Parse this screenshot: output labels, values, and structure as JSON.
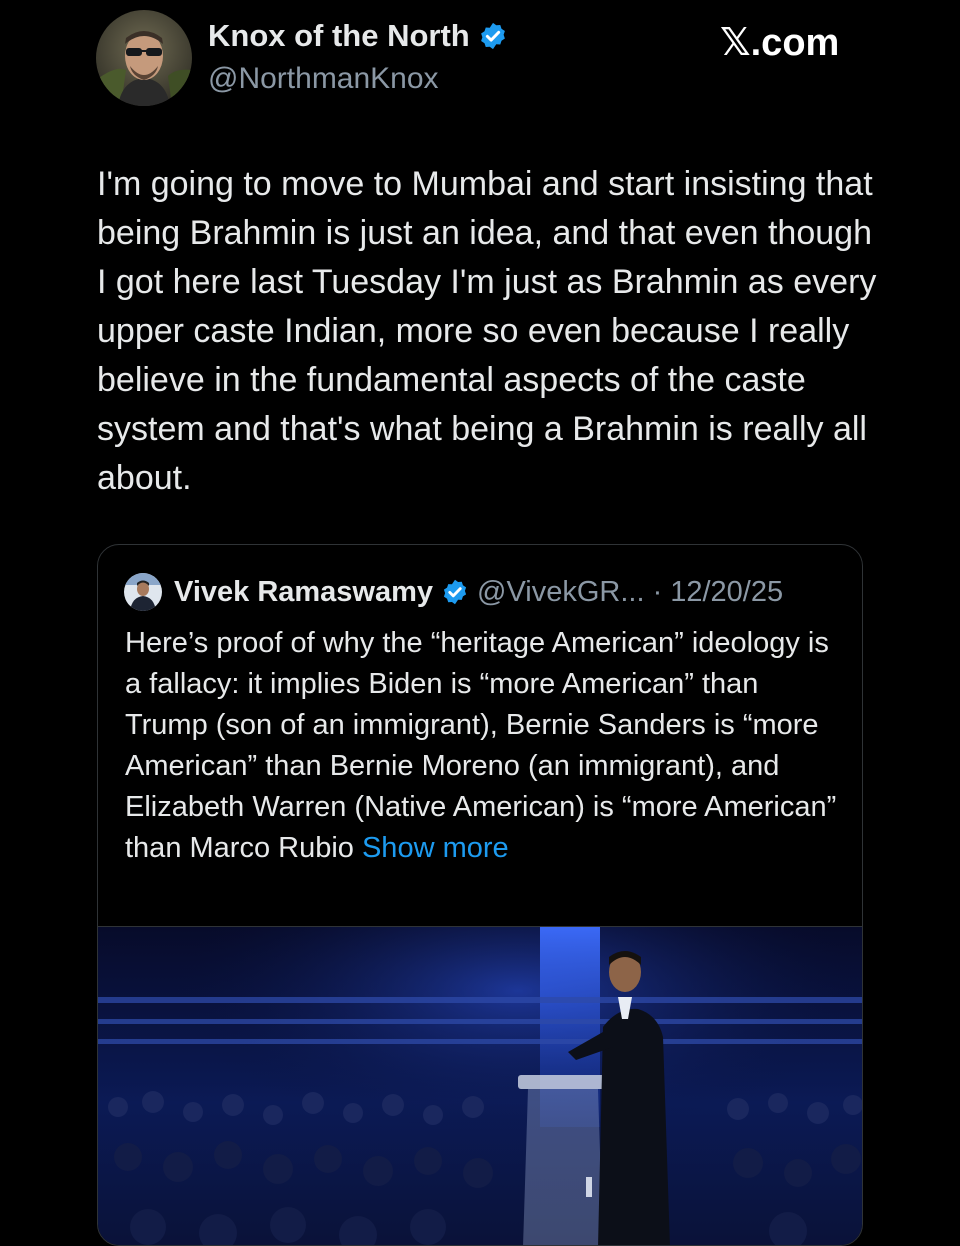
{
  "author": {
    "name": "Knox of the North",
    "handle": "@NorthmanKnox",
    "verified": true
  },
  "site_label": {
    "mark": "𝕏",
    "domain": ".com"
  },
  "post": {
    "text": "I'm going to move to Mumbai and start insisting that being Brahmin is just an idea, and that even though I got here last Tuesday I'm just as Brahmin as every upper caste Indian, more so even because I really believe in the fundamental aspects of the caste system and that's what being a Brahmin is really all about."
  },
  "quoted_post": {
    "name": "Vivek Ramaswamy",
    "handle": "@VivekGR...",
    "separator": "·",
    "date": "12/20/25",
    "verified": true,
    "text": "Here’s proof of why the “heritage American” ideology is a fallacy: it implies Biden is “more American” than Trump (son of an immigrant), Bernie Sanders is “more American” than Bernie Moreno (an immigrant), and Elizabeth Warren (Native American) is “more American” than Marco Rubio ",
    "show_more": "Show more"
  },
  "colors": {
    "background": "#000000",
    "text": "#e7e9ea",
    "secondary_text": "#8b98a5",
    "link": "#1d9bf0",
    "verified_badge": "#1d9bf0",
    "border": "#2f3336"
  },
  "icons": {
    "author_badge": "verified-badge-icon",
    "quote_badge": "verified-badge-icon"
  }
}
